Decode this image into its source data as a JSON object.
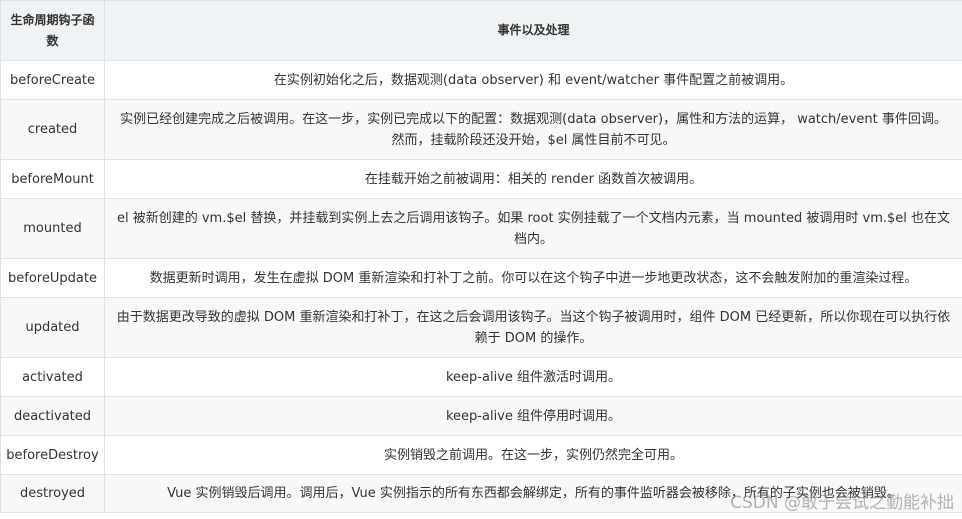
{
  "table": {
    "headers": [
      "生命周期钩子函数",
      "事件以及处理"
    ],
    "rows": [
      {
        "hook": "beforeCreate",
        "desc": "在实例初始化之后，数据观测(data observer) 和 event/watcher 事件配置之前被调用。"
      },
      {
        "hook": "created",
        "desc": "实例已经创建完成之后被调用。在这一步，实例已完成以下的配置：数据观测(data observer)，属性和方法的运算， watch/event 事件回调。然而，挂载阶段还没开始，$el 属性目前不可见。"
      },
      {
        "hook": "beforeMount",
        "desc": "在挂载开始之前被调用：相关的 render 函数首次被调用。"
      },
      {
        "hook": "mounted",
        "desc": "el 被新创建的 vm.$el 替换，并挂载到实例上去之后调用该钩子。如果 root 实例挂载了一个文档内元素，当 mounted 被调用时 vm.$el 也在文档内。"
      },
      {
        "hook": "beforeUpdate",
        "desc": "数据更新时调用，发生在虚拟 DOM 重新渲染和打补丁之前。你可以在这个钩子中进一步地更改状态，这不会触发附加的重渲染过程。"
      },
      {
        "hook": "updated",
        "desc": "由于数据更改导致的虚拟 DOM 重新渲染和打补丁，在这之后会调用该钩子。当这个钩子被调用时，组件 DOM 已经更新，所以你现在可以执行依赖于 DOM 的操作。"
      },
      {
        "hook": "activated",
        "desc": "keep-alive 组件激活时调用。"
      },
      {
        "hook": "deactivated",
        "desc": "keep-alive 组件停用时调用。"
      },
      {
        "hook": "beforeDestroy",
        "desc": "实例销毁之前调用。在这一步，实例仍然完全可用。"
      },
      {
        "hook": "destroyed",
        "desc": "Vue 实例销毁后调用。调用后，Vue 实例指示的所有东西都会解绑定，所有的事件监听器会被移除，所有的子实例也会被销毁。"
      }
    ]
  },
  "watermark": "CSDN @敢于尝试之勤能补拙"
}
